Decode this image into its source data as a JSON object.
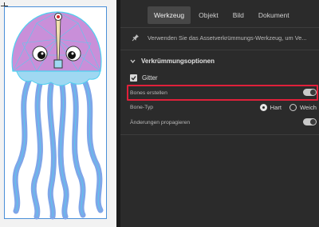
{
  "panel": {
    "tabs": [
      {
        "label": "Werkzeug",
        "active": true
      },
      {
        "label": "Objekt",
        "active": false
      },
      {
        "label": "Bild",
        "active": false
      },
      {
        "label": "Dokument",
        "active": false
      }
    ],
    "hint": "Verwenden Sie das Assetverkrümmungs-Werkzeug, um Ve...",
    "section_title": "Verkrümmungsoptionen",
    "gitter": {
      "label": "Gitter",
      "checked": true
    },
    "bones_erstellen": {
      "label": "Bones erstellen",
      "on": true
    },
    "bone_typ": {
      "label": "Bone-Typ",
      "options": [
        {
          "label": "Hart",
          "selected": true
        },
        {
          "label": "Weich",
          "selected": false
        }
      ]
    },
    "aenderungen": {
      "label": "Änderungen propagieren",
      "on": true
    }
  },
  "colors": {
    "highlight": "#e0203a",
    "jelly_head": "#c98fd9",
    "jelly_tentacle": "#7fa6e8",
    "mesh": "#4fd0f0"
  },
  "icons": [
    "pin-icon",
    "chevron-down-icon",
    "checkmark-icon"
  ]
}
